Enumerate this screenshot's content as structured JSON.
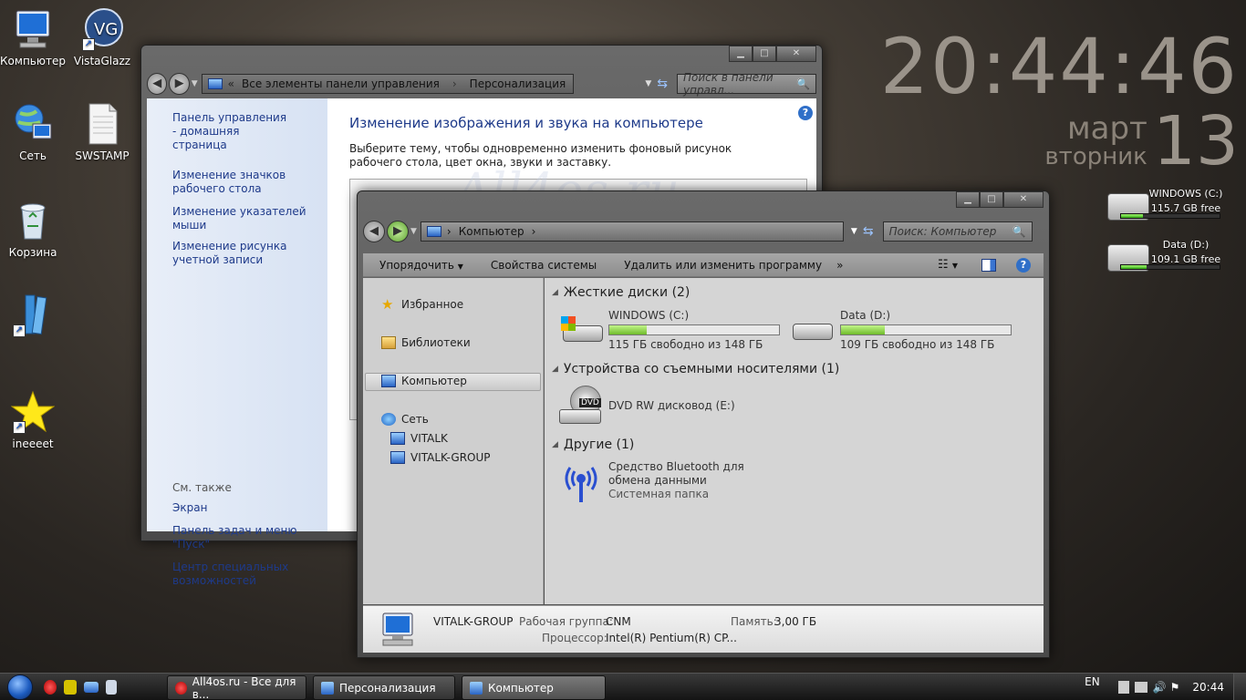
{
  "desktop": {
    "icons": [
      {
        "label": "Компьютер"
      },
      {
        "label": "VistaGlazz"
      },
      {
        "label": "Сеть"
      },
      {
        "label": "SWSTAMP"
      },
      {
        "label": "Корзина"
      },
      {
        "label": ""
      },
      {
        "label": "ineeeet"
      }
    ],
    "watermark": "All4os.ru"
  },
  "clock": {
    "time": "20:44:46",
    "month": "март",
    "day_of_week": "вторник",
    "day": "13"
  },
  "gadgets": [
    {
      "label": "WINDOWS (C:)",
      "free": "115.7 GB free",
      "used_fraction": 0.22
    },
    {
      "label": "Data (D:)",
      "free": "109.1 GB free",
      "used_fraction": 0.26
    }
  ],
  "control_panel": {
    "breadcrumb": [
      "Все элементы панели управления",
      "Персонализация"
    ],
    "search_placeholder": "Поиск в панели управл...",
    "left_links": [
      "Панель управления - домашняя страница",
      "Изменение значков рабочего стола",
      "Изменение указателей мыши",
      "Изменение рисунка учетной записи"
    ],
    "see_also_title": "См. также",
    "see_also": [
      "Экран",
      "Панель задач и меню \"Пуск\"",
      "Центр специальных возможностей"
    ],
    "heading": "Изменение изображения и звука на компьютере",
    "description": "Выберите тему, чтобы одновременно изменить фоновый рисунок рабочего стола, цвет окна, звуки и заставку."
  },
  "explorer": {
    "breadcrumb": "Компьютер",
    "search_placeholder": "Поиск: Компьютер",
    "toolbar": [
      "Упорядочить",
      "Свойства системы",
      "Удалить или изменить программу",
      "»"
    ],
    "nav": {
      "favorites": "Избранное",
      "libraries": "Библиотеки",
      "computer": "Компьютер",
      "network": "Сеть",
      "network_items": [
        "VITALK",
        "VITALK-GROUP"
      ]
    },
    "groups": {
      "hdd": "Жесткие диски (2)",
      "removable": "Устройства со съемными носителями (1)",
      "other": "Другие (1)"
    },
    "drives": [
      {
        "name": "WINDOWS (C:)",
        "free": "115 ГБ свободно из 148 ГБ",
        "used_fraction": 0.22
      },
      {
        "name": "Data (D:)",
        "free": "109 ГБ свободно из 148 ГБ",
        "used_fraction": 0.26
      }
    ],
    "dvd": {
      "name": "DVD RW дисковод (E:)",
      "badge": "DVD"
    },
    "bluetooth": {
      "name": "Средство Bluetooth для обмена данными",
      "type": "Системная папка"
    },
    "details": {
      "computer_name": "VITALK-GROUP",
      "workgroup_label": "Рабочая группа:",
      "workgroup": "CNM",
      "memory_label": "Память:",
      "memory": "3,00 ГБ",
      "cpu_label": "Процессор:",
      "cpu": "Intel(R) Pentium(R) CP..."
    }
  },
  "taskbar": {
    "tasks": [
      "All4os.ru - Все для в...",
      "Персонализация",
      "Компьютер"
    ],
    "language": "EN",
    "time": "20:44"
  }
}
